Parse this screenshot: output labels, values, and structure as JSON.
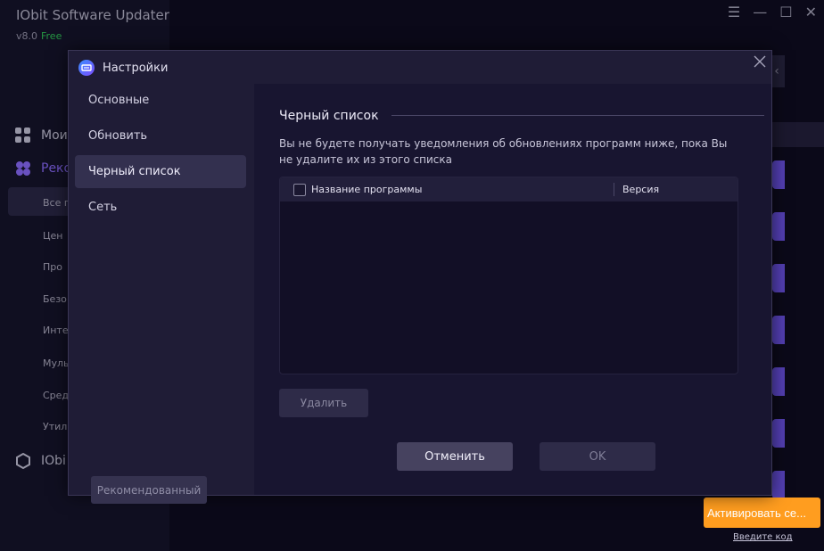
{
  "app": {
    "title": "IObit Software Updater 8",
    "version": "v8.0",
    "edition": "Free",
    "nav": [
      {
        "label": "Мои",
        "icon": "grid-icon"
      },
      {
        "label": "Реко",
        "icon": "recommend-icon"
      },
      {
        "label": "IObi",
        "icon": "iobit-icon"
      }
    ],
    "sub_items": [
      "Все п",
      "Цен",
      "Про",
      "Безо",
      "Инте",
      "Муль",
      "Сред",
      "Утил"
    ],
    "activate_button": "Активировать се...",
    "enter_code_link": "Введите код",
    "accent_color": "#6f55ee",
    "activate_color": "#ff9d1f"
  },
  "dialog": {
    "title": "Настройки",
    "nav_items": [
      {
        "label": "Основные",
        "active": false
      },
      {
        "label": "Обновить",
        "active": false
      },
      {
        "label": "Черный список",
        "active": true
      },
      {
        "label": "Сеть",
        "active": false
      }
    ],
    "recommended_button": "Рекомендованный",
    "section_title": "Черный список",
    "description": "Вы не будете получать уведомления об обновлениях программ ниже, пока Вы не удалите их из этого списка",
    "table": {
      "columns": [
        "Название программы",
        "Версия"
      ],
      "rows": []
    },
    "delete_button": "Удалить",
    "cancel_button": "Отменить",
    "ok_button": "OK"
  }
}
